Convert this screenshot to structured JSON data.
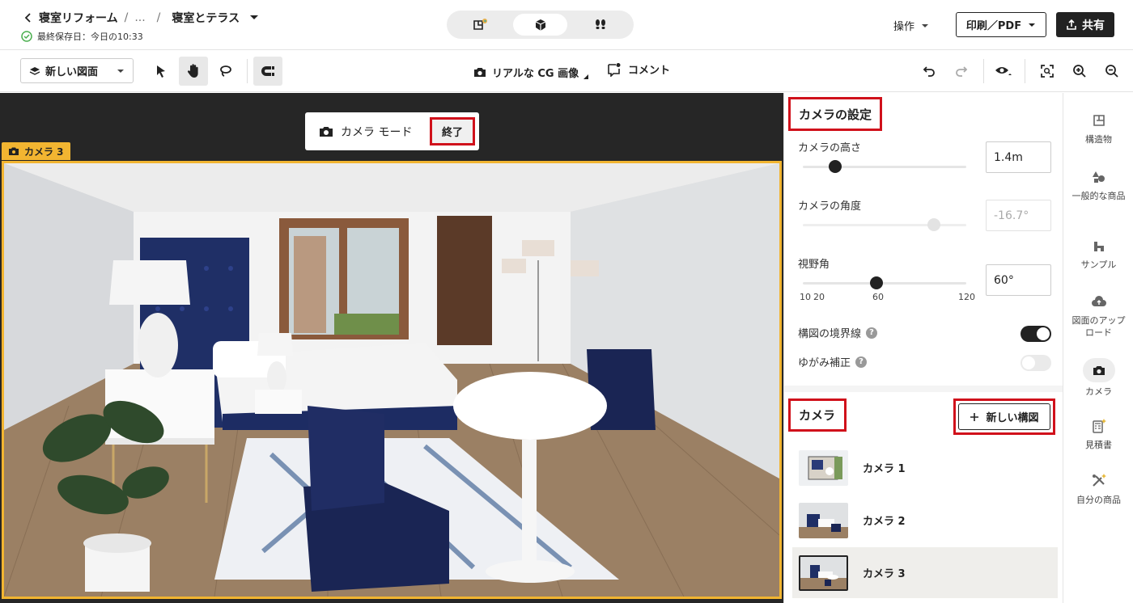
{
  "header": {
    "back_label": "寝室リフォーム",
    "ellipsis": "...",
    "separator": "/",
    "project_title": "寝室とテラス",
    "saved_text": "最終保存日：今日の10:33",
    "operation_label": "操作",
    "print_label": "印刷／PDF",
    "share_label": "共有"
  },
  "toolbar": {
    "new_plan_label": "新しい図面",
    "cg_label": "リアルな CG 画像",
    "comment_label": "コメント"
  },
  "canvas": {
    "camera_mode_label": "カメラ モード",
    "end_label": "終了",
    "camera_tag": "カメラ 3"
  },
  "camera_settings": {
    "title": "カメラの設定",
    "height_label": "カメラの高さ",
    "height_value": "1.4m",
    "height_fraction": 0.2,
    "angle_label": "カメラの角度",
    "angle_value": "-16.7°",
    "angle_fraction": 0.8,
    "fov_label": "視野角",
    "fov_value": "60°",
    "fov_fraction": 0.45,
    "fov_ticks": [
      "10",
      "20",
      "60",
      "120"
    ],
    "boundary_label": "構図の境界線",
    "boundary_on": true,
    "distortion_label": "ゆがみ補正",
    "distortion_on": false,
    "help": "?"
  },
  "cameras": {
    "title": "カメラ",
    "new_button_label": "新しい構図",
    "items": [
      {
        "label": "カメラ 1"
      },
      {
        "label": "カメラ 2"
      },
      {
        "label": "カメラ 3",
        "selected": true
      }
    ]
  },
  "rail": {
    "items": [
      {
        "label": "構造物",
        "icon": "floorplan-icon"
      },
      {
        "label": "一般的な商品",
        "icon": "shapes-icon"
      },
      {
        "label": "サンプル",
        "icon": "house-icon"
      },
      {
        "label": "図面のアップロード",
        "icon": "cloud-upload-icon"
      },
      {
        "label": "カメラ",
        "icon": "camera-icon",
        "active": true
      },
      {
        "label": "見積書",
        "icon": "calculator-icon"
      },
      {
        "label": "自分の商品",
        "icon": "tools-icon"
      }
    ]
  },
  "colors": {
    "highlight": "#d0111b",
    "camera_accent": "#f2b531",
    "dark": "#222222"
  }
}
